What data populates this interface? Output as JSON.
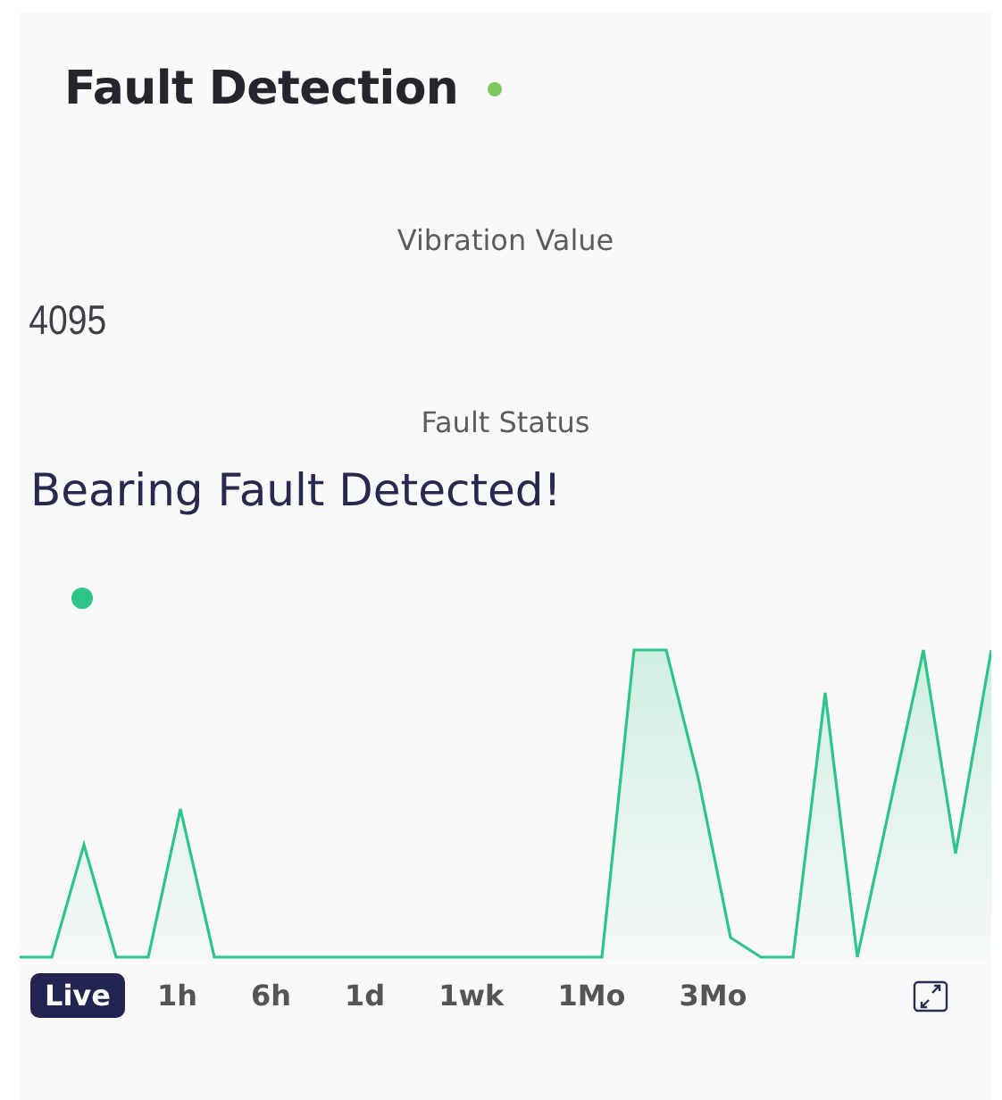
{
  "widget": {
    "title": "Fault Detection"
  },
  "vibration": {
    "label": "Vibration Value",
    "value": "4095"
  },
  "fault": {
    "label": "Fault Status",
    "value": "Bearing Fault Detected!"
  },
  "ranges": [
    {
      "label": "Live",
      "selected": true
    },
    {
      "label": "1h",
      "selected": false
    },
    {
      "label": "6h",
      "selected": false
    },
    {
      "label": "1d",
      "selected": false
    },
    {
      "label": "1wk",
      "selected": false
    },
    {
      "label": "1Mo",
      "selected": false
    },
    {
      "label": "3Mo",
      "selected": false
    }
  ]
}
